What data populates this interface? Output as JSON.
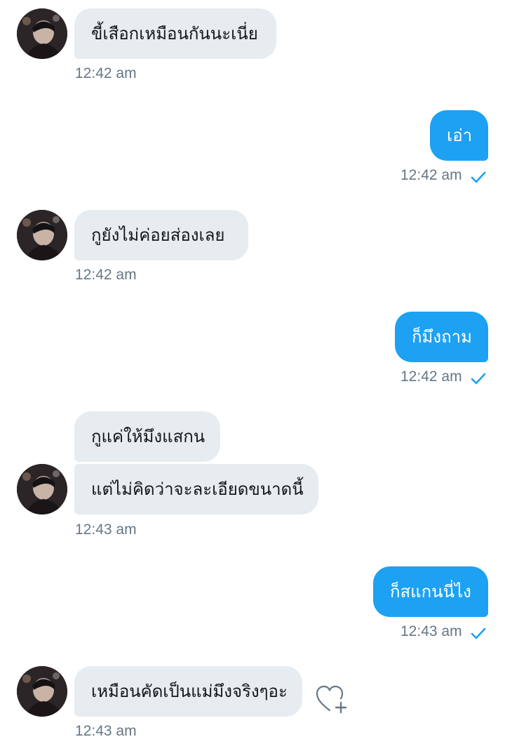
{
  "colors": {
    "incoming_bubble": "#e6ecf0",
    "outgoing_bubble": "#1da1f2",
    "timestamp": "#657786",
    "check": "#1da1f2"
  },
  "messages": [
    {
      "direction": "incoming",
      "texts": [
        "ขี้เสือกเหมือนกันนะเนี่ย"
      ],
      "time": "12:42 am"
    },
    {
      "direction": "outgoing",
      "texts": [
        "เอ่า"
      ],
      "time": "12:42 am",
      "status_icon": "check-icon"
    },
    {
      "direction": "incoming",
      "texts": [
        "กูยังไม่ค่อยส่องเลย"
      ],
      "time": "12:42 am"
    },
    {
      "direction": "outgoing",
      "texts": [
        "ก็มึงถาม"
      ],
      "time": "12:42 am",
      "status_icon": "check-icon"
    },
    {
      "direction": "incoming",
      "texts": [
        "กูแค่ให้มึงแสกน",
        "แต่ไม่คิดว่าจะละเอียดขนาดนี้"
      ],
      "time": "12:43 am"
    },
    {
      "direction": "outgoing",
      "texts": [
        "ก็สแกนนี่ไง"
      ],
      "time": "12:43 am",
      "status_icon": "check-icon"
    },
    {
      "direction": "incoming",
      "texts": [
        "เหมือนคัดเป็นแม่มึงจริงๆอะ"
      ],
      "time": "12:43 am",
      "action_icon": "heart-plus-icon"
    }
  ]
}
